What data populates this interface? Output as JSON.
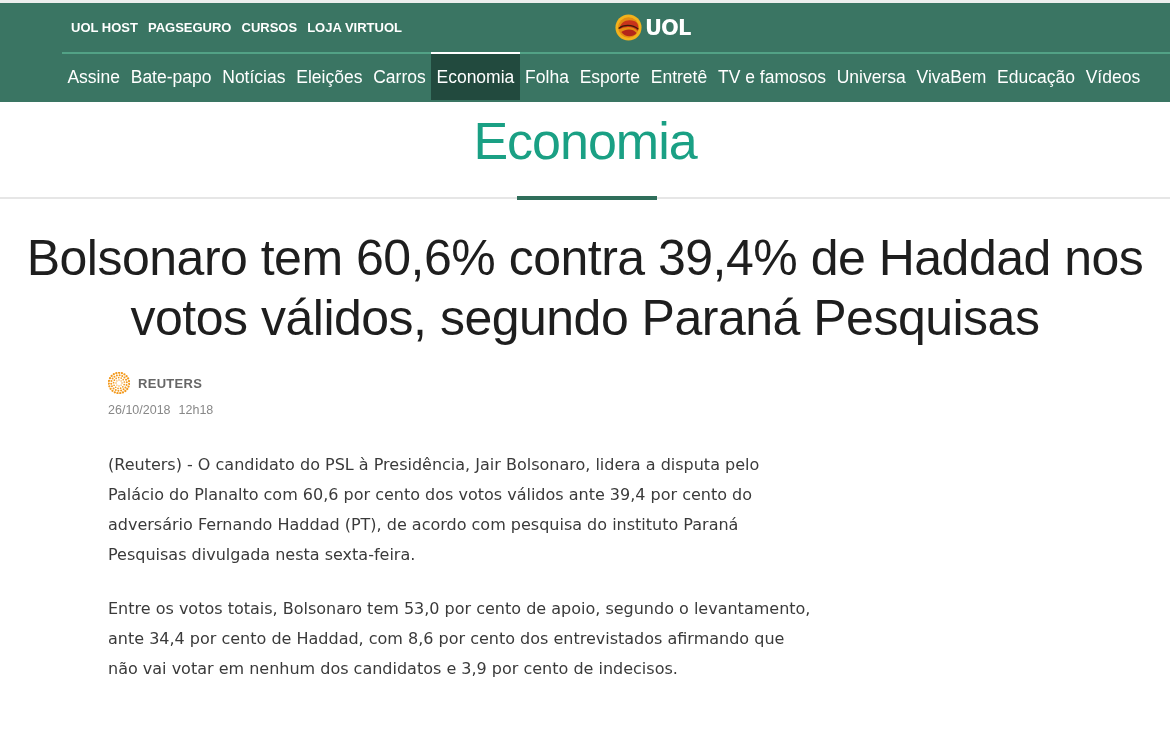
{
  "header": {
    "top_links": [
      "UOL HOST",
      "PAGSEGURO",
      "CURSOS",
      "LOJA VIRTUOL"
    ],
    "logo": {
      "text": "UOL"
    },
    "nav": [
      {
        "label": "Assine",
        "selected": false
      },
      {
        "label": "Bate-papo",
        "selected": false
      },
      {
        "label": "Notícias",
        "selected": false
      },
      {
        "label": "Eleições",
        "selected": false
      },
      {
        "label": "Carros",
        "selected": false
      },
      {
        "label": "Economia",
        "selected": true
      },
      {
        "label": "Folha",
        "selected": false
      },
      {
        "label": "Esporte",
        "selected": false
      },
      {
        "label": "Entretê",
        "selected": false
      },
      {
        "label": "TV e famosos",
        "selected": false
      },
      {
        "label": "Universa",
        "selected": false
      },
      {
        "label": "VivaBem",
        "selected": false
      },
      {
        "label": "Educação",
        "selected": false
      },
      {
        "label": "Vídeos",
        "selected": false
      }
    ]
  },
  "section": {
    "title": "Economia"
  },
  "article": {
    "headline": "Bolsonaro tem 60,6% contra 39,4% de Haddad nos votos válidos, segundo Paraná Pesquisas",
    "source": "REUTERS",
    "date": "26/10/2018",
    "time": "12h18",
    "paragraphs": [
      "(Reuters) - O candidato do PSL à Presidência, Jair Bolsonaro, lidera a disputa pelo Palácio do Planalto com 60,6 por cento dos votos válidos ante 39,4 por cento do adversário Fernando Haddad (PT), de acordo com pesquisa do instituto Paraná Pesquisas divulgada nesta sexta-feira.",
      "Entre os votos totais, Bolsonaro tem 53,0 por cento de apoio, segundo o levantamento, ante 34,4 por cento de Haddad, com 8,6 por cento dos entrevistados afirmando que não vai votar em nenhum dos candidatos e 3,9 por cento de indecisos."
    ]
  }
}
